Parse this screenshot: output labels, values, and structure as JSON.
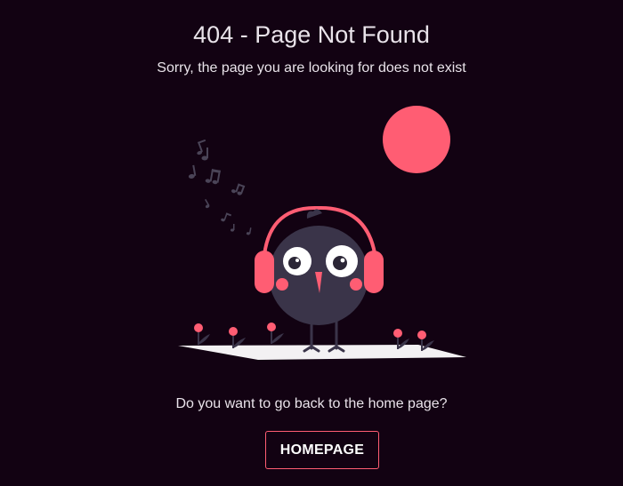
{
  "page": {
    "title": "404 - Page Not Found",
    "subtitle": "Sorry, the page you are looking for does not exist",
    "question": "Do you want to go back to the home page?",
    "button_label": "HOMEPAGE"
  },
  "colors": {
    "background": "#120212",
    "accent": "#ff5d73",
    "bird_body": "#3a3449",
    "text": "#e9e3ea"
  },
  "icons": {
    "illustration": "bird-with-headphones",
    "notes": "music-notes-icon",
    "sun": "moon-circle"
  }
}
